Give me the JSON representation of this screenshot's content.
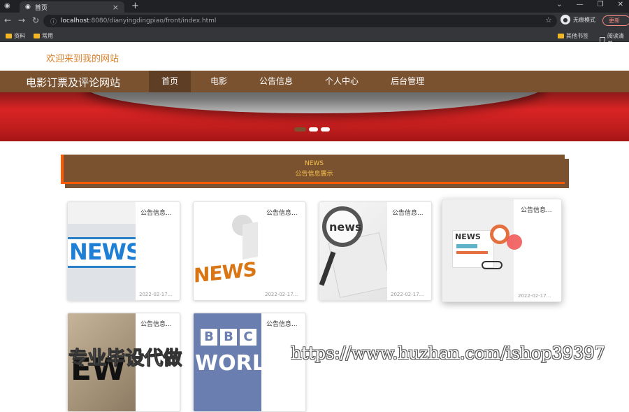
{
  "browser": {
    "tab_title": "首页",
    "url_host": "localhost",
    "url_rest": ":8080/dianyingdingpiao/front/index.html",
    "profile_label": "无痕模式",
    "update_label": "更新",
    "bookmarks": [
      {
        "label": "资料"
      },
      {
        "label": "常用"
      },
      {
        "label": "其他书签"
      },
      {
        "label": "阅读清单"
      }
    ]
  },
  "site": {
    "welcome": "欢迎来到我的网站",
    "brand": "电影订票及评论网站",
    "menu": [
      {
        "label": "首页",
        "active": true
      },
      {
        "label": "电影",
        "active": false
      },
      {
        "label": "公告信息",
        "active": false
      },
      {
        "label": "个人中心",
        "active": false
      },
      {
        "label": "后台管理",
        "active": false
      }
    ],
    "carousel_dots": 3,
    "carousel_active": 0
  },
  "news_section": {
    "title_en": "NEWS",
    "title_cn": "公告信息展示"
  },
  "cards": [
    {
      "title": "公告信息...",
      "date": "2022-02-17...",
      "thumb_text": "NEWS"
    },
    {
      "title": "公告信息...",
      "date": "2022-02-17...",
      "thumb_text": "NEWS"
    },
    {
      "title": "公告信息...",
      "date": "2022-02-17...",
      "thumb_text": "news"
    },
    {
      "title": "公告信息...",
      "date": "2022-02-17...",
      "thumb_text": "NEWS"
    },
    {
      "title": "公告信息...",
      "thumb_text": "EW"
    },
    {
      "title": "公告信息...",
      "thumb_text_top": [
        "B",
        "B",
        "C"
      ],
      "thumb_text": "WORLD"
    }
  ],
  "watermark": {
    "text_cn": "专业毕设代做",
    "text_url": "https://www.huzhan.com/ishop39397"
  }
}
